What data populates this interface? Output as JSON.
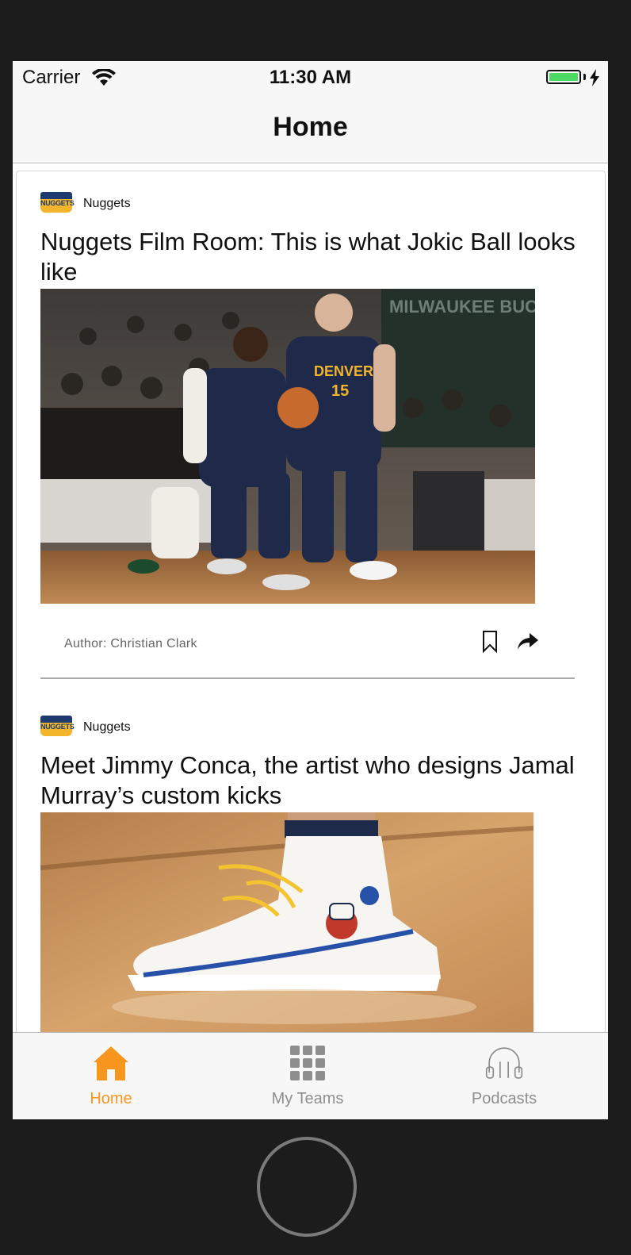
{
  "status_bar": {
    "carrier": "Carrier",
    "time": "11:30 AM"
  },
  "nav": {
    "title": "Home"
  },
  "articles": [
    {
      "source": "Nuggets",
      "logo_text": "NUGGETS",
      "headline": "Nuggets Film Room: This is what Jokic Ball looks like",
      "author": "Author: Christian Clark",
      "jersey_text": "DENVER",
      "jersey_number": "15",
      "banner_text": "MILWAUKEE BUCKS"
    },
    {
      "source": "Nuggets",
      "logo_text": "NUGGETS",
      "headline": "Meet Jimmy Conca, the artist who designs Jamal Murray’s custom kicks"
    }
  ],
  "tabs": [
    {
      "label": "Home",
      "icon": "home-icon",
      "active": true
    },
    {
      "label": "My Teams",
      "icon": "grid-icon",
      "active": false
    },
    {
      "label": "Podcasts",
      "icon": "headphones-icon",
      "active": false
    }
  ],
  "colors": {
    "accent": "#f7961c",
    "inactive": "#8e8e8e",
    "nuggets_navy": "#1d3b6e",
    "nuggets_gold": "#f2b52b"
  }
}
